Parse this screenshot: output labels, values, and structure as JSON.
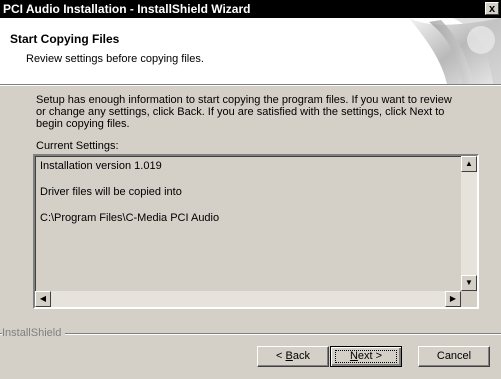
{
  "window": {
    "title": "PCI Audio Installation - InstallShield Wizard",
    "close_label": "x"
  },
  "header": {
    "title": "Start Copying Files",
    "subtitle": "Review settings before copying files."
  },
  "body": {
    "info_text": "Setup has enough information to start copying the program files.  If you want to review or change any settings, click Back.  If you are satisfied with the settings, click Next to begin copying files.",
    "settings_label": "Current Settings:",
    "settings_lines": [
      "Installation version 1.019",
      "Driver files will be copied into",
      "C:\\Program Files\\C-Media PCI Audio"
    ]
  },
  "footer": {
    "brand": "InstallShield",
    "buttons": {
      "back_prefix": "< ",
      "back_hotkey": "B",
      "back_rest": "ack",
      "next_hotkey": "N",
      "next_rest": "ext >",
      "cancel": "Cancel"
    }
  },
  "colors": {
    "dialog_bg": "#d4d0c8",
    "titlebar_bg": "#000000",
    "header_bg": "#ffffff"
  }
}
